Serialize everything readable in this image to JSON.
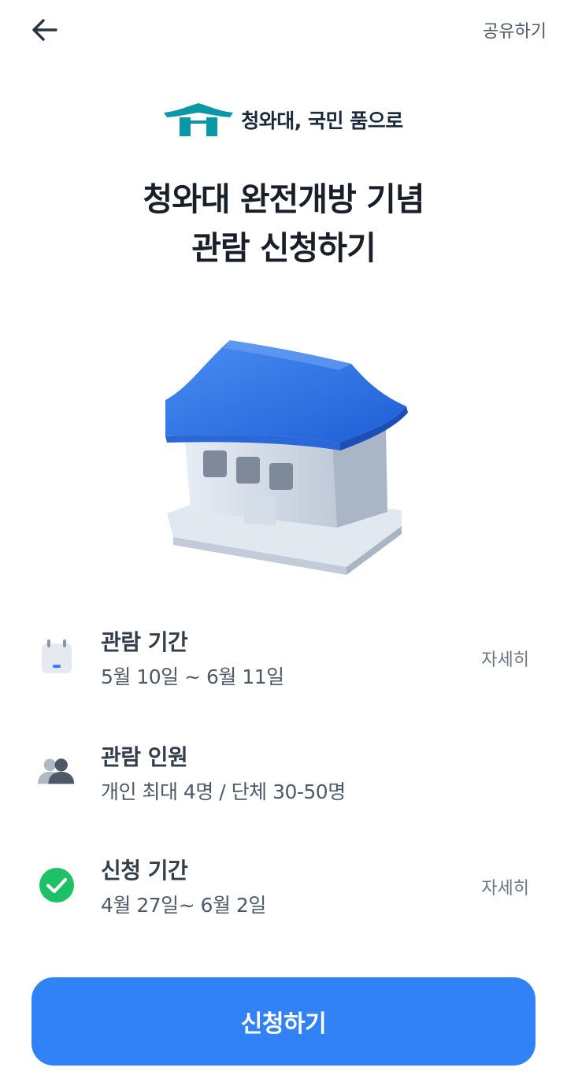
{
  "header": {
    "share_label": "공유하기"
  },
  "brand": {
    "name": "청와대, 국민 품으로"
  },
  "title": {
    "line1": "청와대 완전개방 기념",
    "line2": "관람 신청하기"
  },
  "info": [
    {
      "label": "관람 기간",
      "value": "5월 10일 ~ 6월 11일",
      "detail": "자세히",
      "icon": "calendar-icon"
    },
    {
      "label": "관람 인원",
      "value": "개인 최대 4명 / 단체 30-50명",
      "detail": "",
      "icon": "people-icon"
    },
    {
      "label": "신청 기간",
      "value": "4월 27일~ 6월 2일",
      "detail": "자세히",
      "icon": "check-circle-icon"
    }
  ],
  "cta": {
    "label": "신청하기"
  },
  "colors": {
    "accent": "#3182f6",
    "check": "#1fc166",
    "brand_teal": "#0a97a8"
  }
}
